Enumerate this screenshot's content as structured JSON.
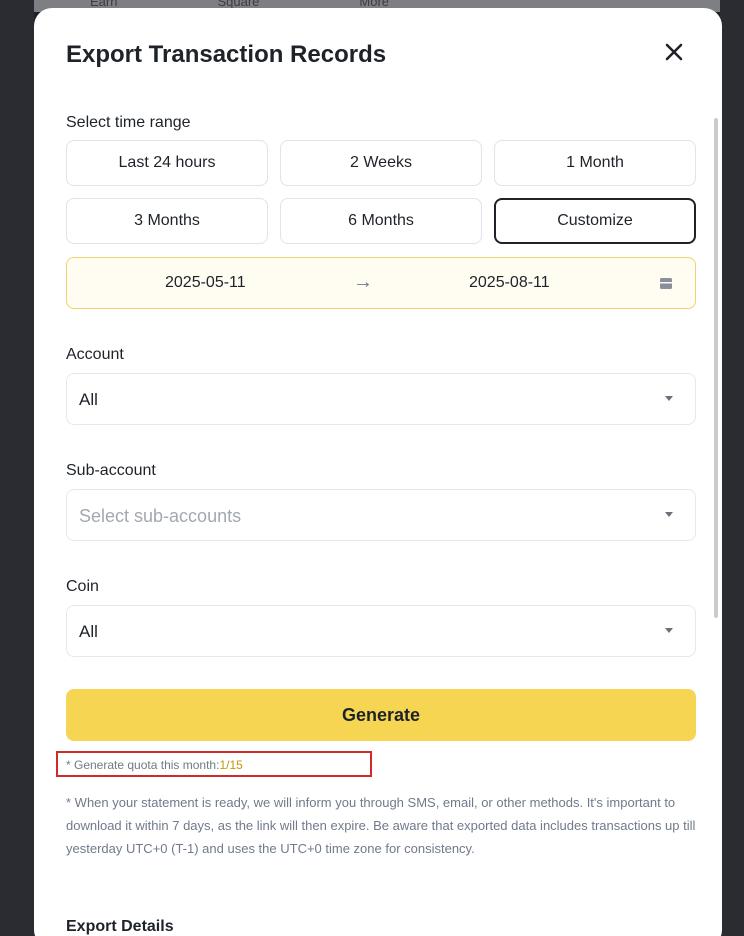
{
  "background_nav": [
    "Earn",
    "Square",
    "More"
  ],
  "modal": {
    "title": "Export Transaction Records",
    "close_icon": "close-icon"
  },
  "time_range": {
    "label": "Select time range",
    "options": [
      "Last 24 hours",
      "2 Weeks",
      "1 Month",
      "3 Months",
      "6 Months",
      "Customize"
    ],
    "selected": "Customize",
    "start_date": "2025-05-11",
    "end_date": "2025-08-11",
    "arrow": "→",
    "calendar_icon": "calendar-icon"
  },
  "account": {
    "label": "Account",
    "value": "All"
  },
  "sub_account": {
    "label": "Sub-account",
    "placeholder": "Select sub-accounts"
  },
  "coin": {
    "label": "Coin",
    "value": "All"
  },
  "generate_label": "Generate",
  "quota": {
    "prefix": "* Generate quota this month:",
    "count": "1/15"
  },
  "note": "* When your statement is ready, we will inform you through SMS, email, or other methods. It's important to download it within 7 days, as the link will then expire. Be aware that exported data includes transactions up till yesterday UTC+0 (T-1) and uses the UTC+0 time zone for consistency.",
  "bottom_label": "Export Details",
  "colors": {
    "accent": "#f6d552",
    "highlight_border": "#d02b2b",
    "quota_count": "#c99400"
  }
}
